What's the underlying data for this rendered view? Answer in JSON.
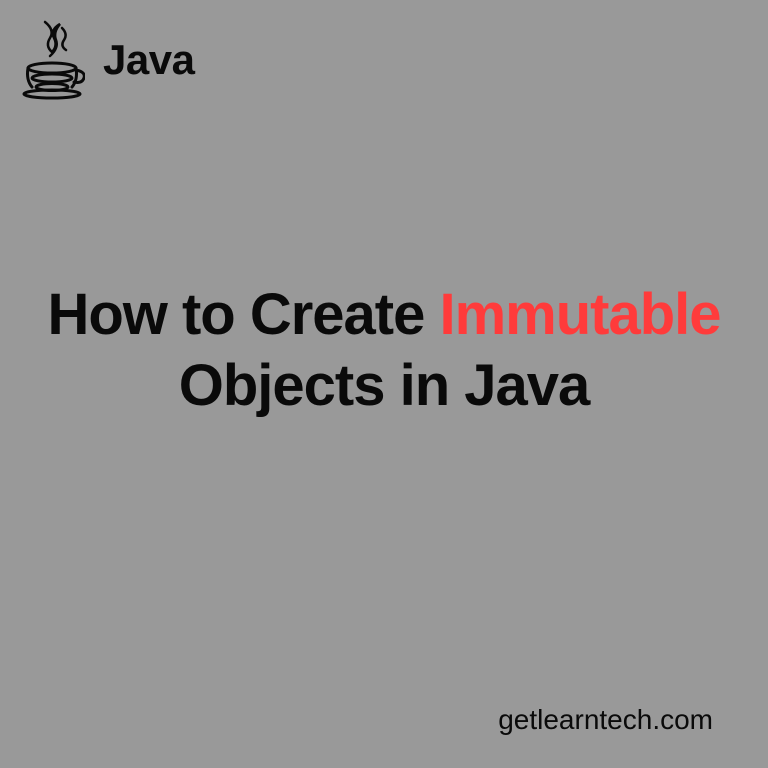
{
  "logo": {
    "text": "Java",
    "icon_name": "java-logo-icon"
  },
  "title": {
    "part1": "How to Create ",
    "highlighted": "Immutable",
    "part2": " Objects in Java"
  },
  "footer": {
    "text": "getlearntech.com"
  },
  "colors": {
    "background": "#999999",
    "text_primary": "#0a0a0a",
    "highlight": "#ff3b3b"
  }
}
